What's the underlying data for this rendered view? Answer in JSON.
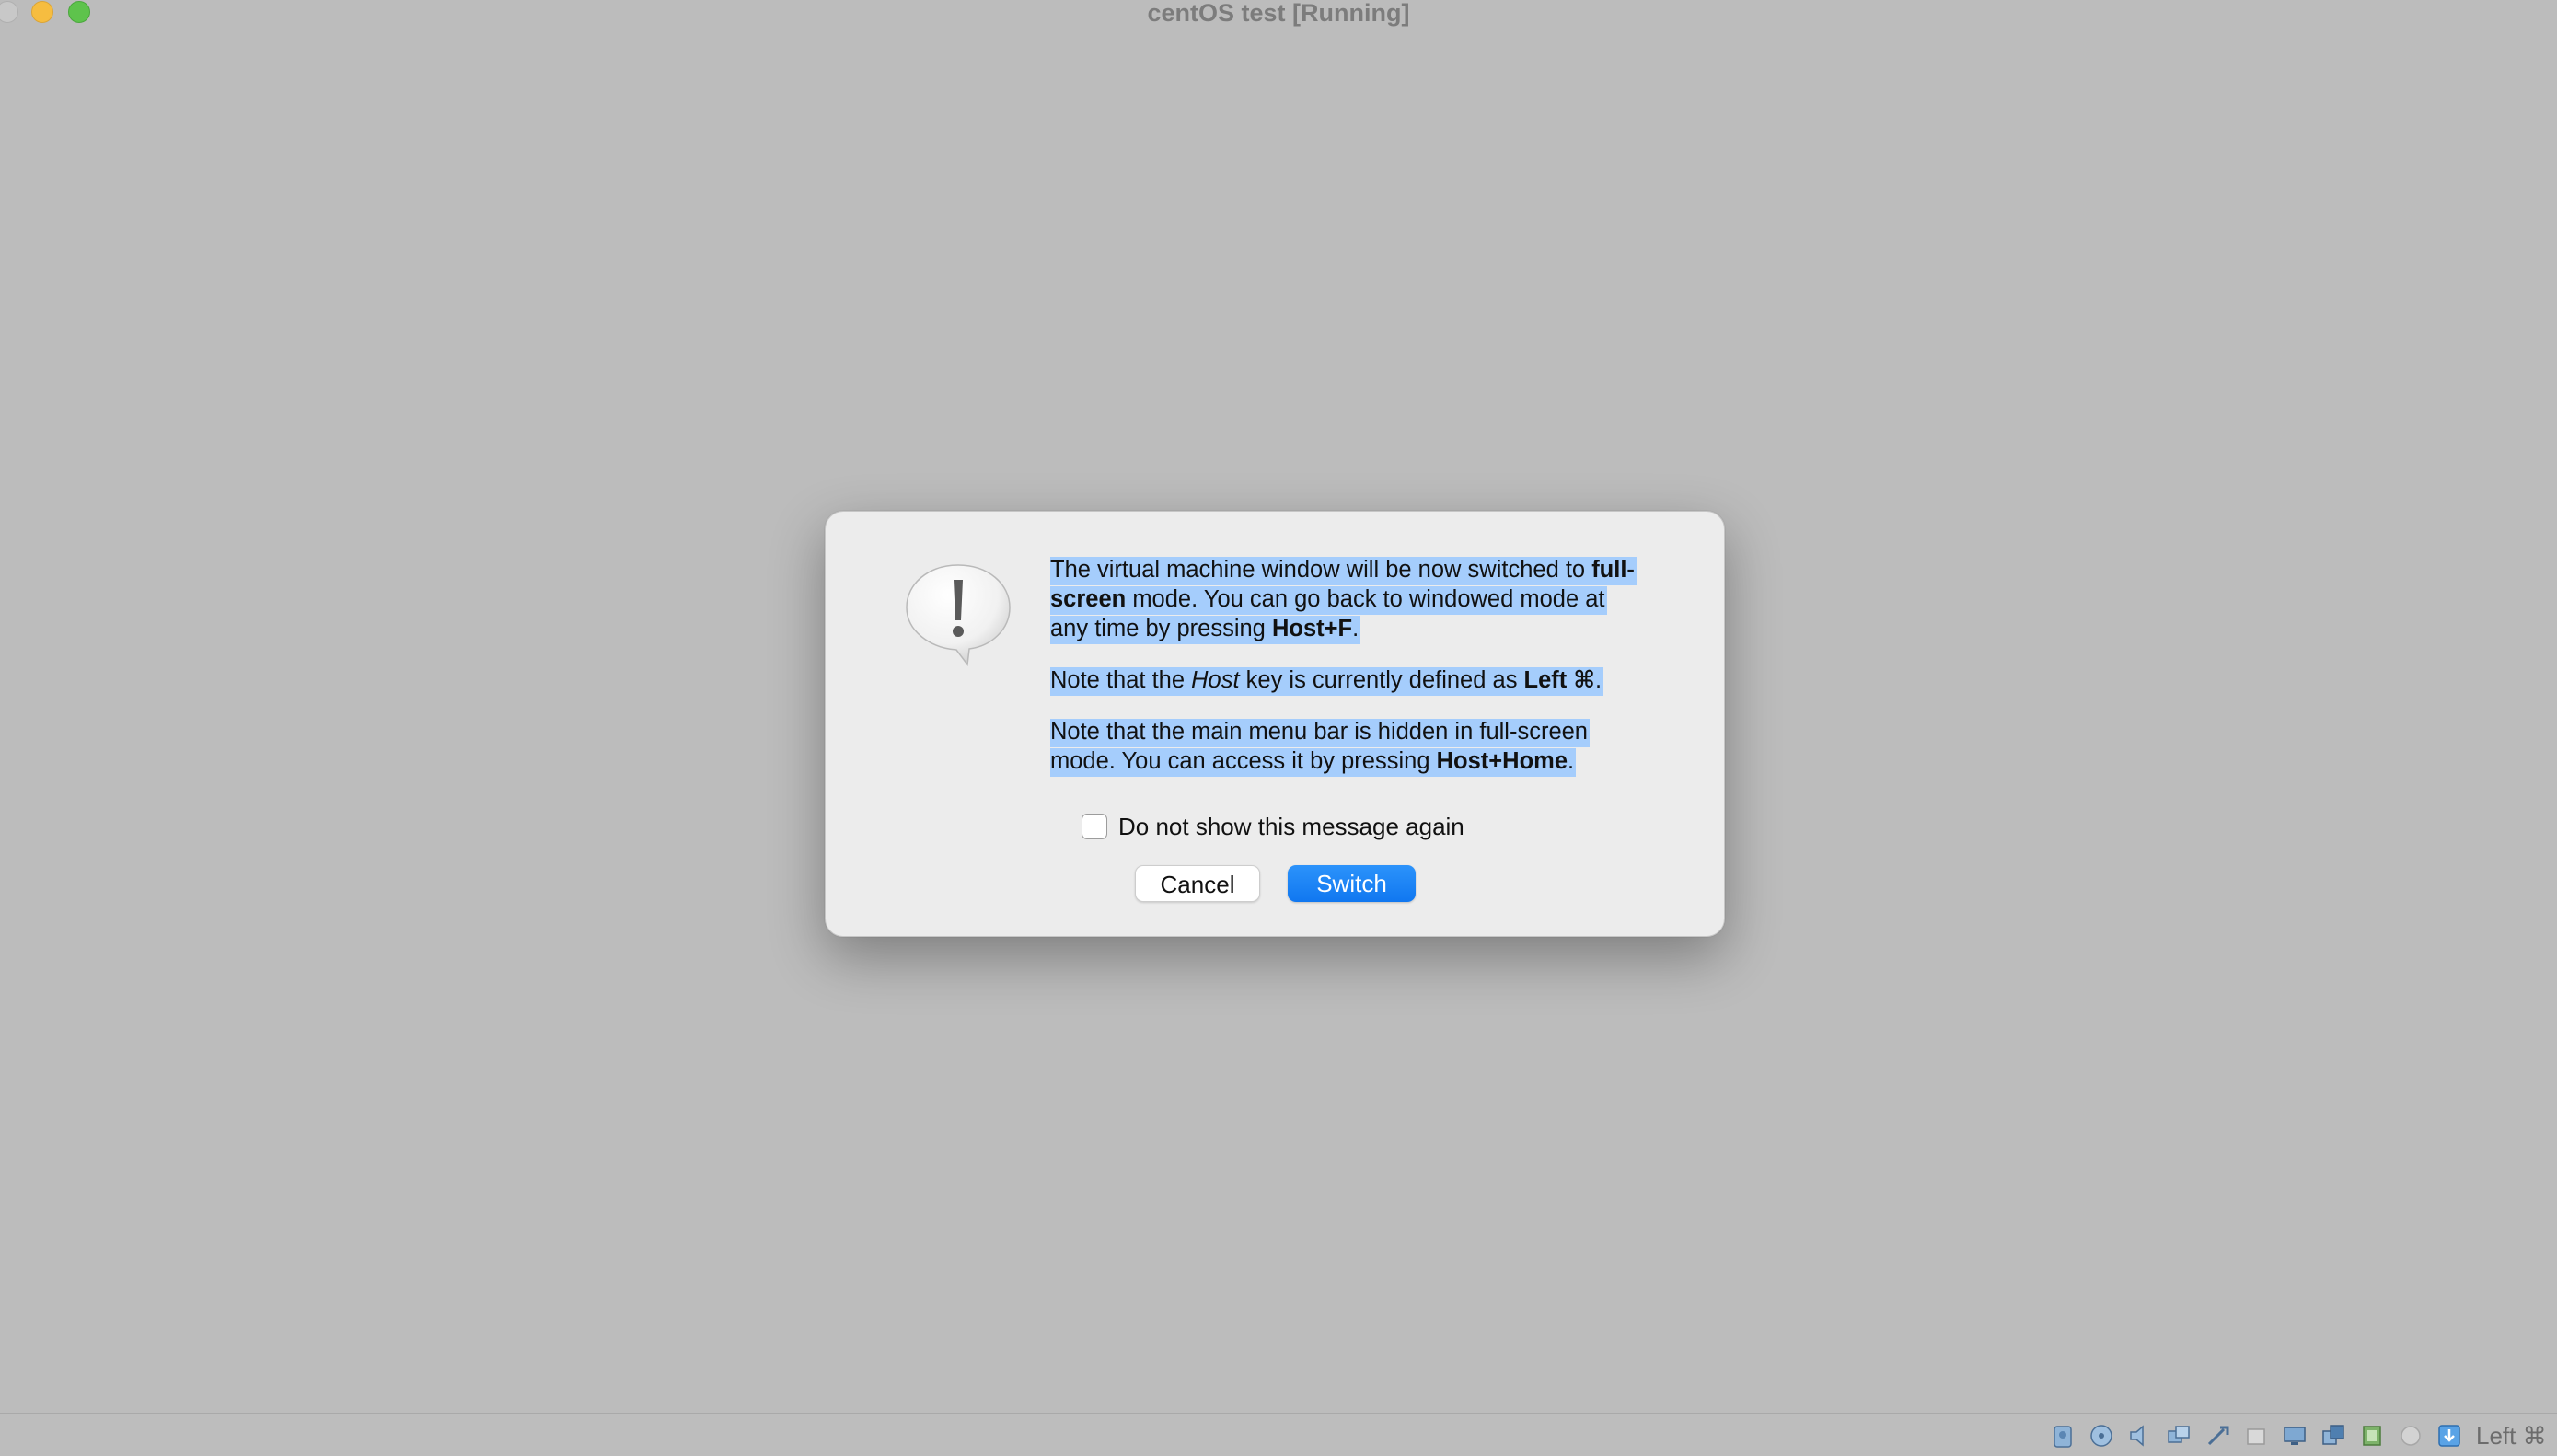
{
  "window": {
    "title": "centOS test [Running]"
  },
  "dialog": {
    "message_paragraphs": [
      {
        "runs": [
          {
            "text": "The virtual machine window will be now switched to "
          },
          {
            "text": "full-screen",
            "bold": true
          },
          {
            "text": " mode. You can go back to windowed mode at any time by pressing "
          },
          {
            "text": "Host+F",
            "bold": true
          },
          {
            "text": "."
          }
        ]
      },
      {
        "runs": [
          {
            "text": "Note that the "
          },
          {
            "text": "Host",
            "italic": true
          },
          {
            "text": " key is currently defined as "
          },
          {
            "text": "Left ⌘",
            "bold": true
          },
          {
            "text": "."
          }
        ]
      },
      {
        "runs": [
          {
            "text": "Note that the main menu bar is hidden in full-screen mode. You can access it by pressing "
          },
          {
            "text": "Host+Home",
            "bold": true
          },
          {
            "text": "."
          }
        ]
      }
    ],
    "checkbox_label": "Do not show this message again",
    "checkbox_checked": false,
    "cancel_label": "Cancel",
    "switch_label": "Switch",
    "accent_color": "#1a82f7",
    "selection_color": "#a5cdfc"
  },
  "statusbar": {
    "icons": [
      "hard-disk-icon",
      "optical-drive-icon",
      "audio-icon",
      "network-icon",
      "usb-icon",
      "shared-folders-icon",
      "display-icon",
      "recording-icon",
      "cpu-icon",
      "mouse-integration-icon",
      "keyboard-capture-icon"
    ],
    "host_key_label": "Left ⌘"
  }
}
